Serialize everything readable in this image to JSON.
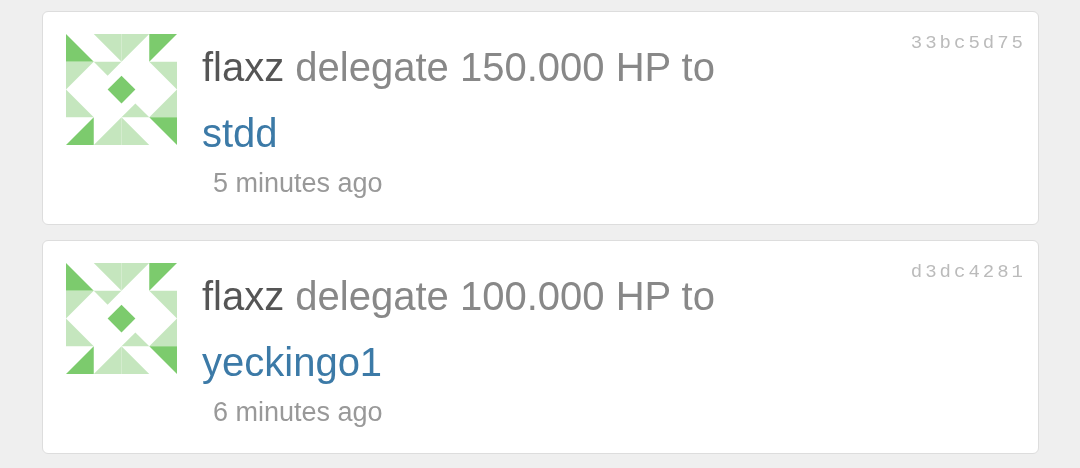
{
  "activities": [
    {
      "author": "flaxz",
      "action": "delegate 150.000 HP to",
      "recipient": "stdd",
      "time": "5 minutes ago",
      "hash": "33bc5d75"
    },
    {
      "author": "flaxz",
      "action": "delegate 100.000 HP to",
      "recipient": "yeckingo1",
      "time": "6 minutes ago",
      "hash": "d3dc4281"
    }
  ]
}
